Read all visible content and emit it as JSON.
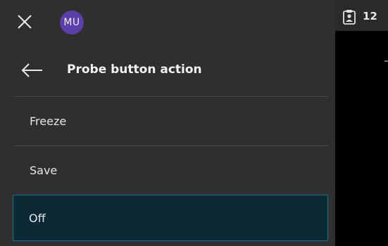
{
  "topbar": {
    "avatar_initials": "MU"
  },
  "header": {
    "title": "Probe button action"
  },
  "menu": {
    "items": [
      {
        "label": "Freeze",
        "selected": false
      },
      {
        "label": "Save",
        "selected": false
      },
      {
        "label": "Off",
        "selected": true
      }
    ]
  },
  "status": {
    "clipboard_count": "12"
  },
  "colors": {
    "panel_bg": "#2f2f2f",
    "avatar_bg": "#5b3fa8",
    "selected_bg": "#0c2a35",
    "selected_border": "#1b6f8a"
  },
  "icons": [
    "close-icon",
    "back-arrow-icon",
    "clipboard-user-icon"
  ]
}
